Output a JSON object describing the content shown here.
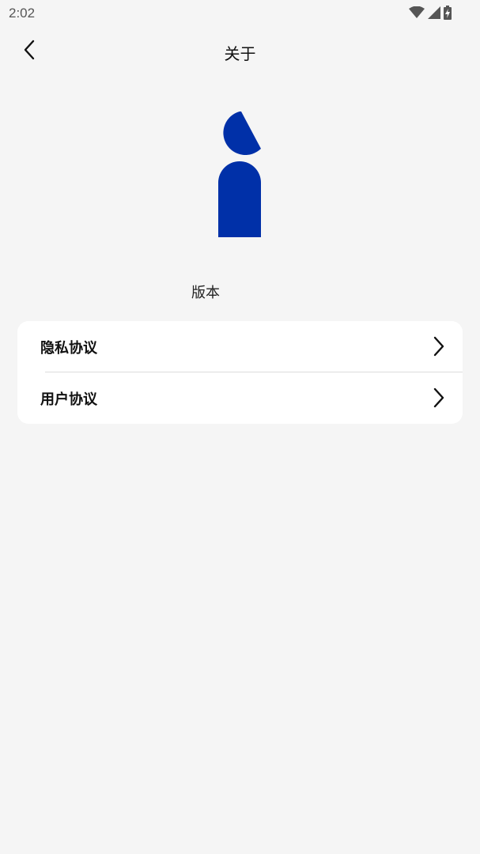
{
  "status_bar": {
    "time": "2:02",
    "icons": [
      "wifi-icon",
      "cellular-signal-icon",
      "battery-charging-icon"
    ]
  },
  "app_bar": {
    "title": "关于",
    "back_icon": "chevron-left-icon"
  },
  "logo": {
    "icon": "app-logo-i",
    "color": "#0030a8"
  },
  "version": {
    "label": "版本"
  },
  "settings": {
    "items": [
      {
        "label": "隐私协议",
        "icon": "chevron-right-icon"
      },
      {
        "label": "用户协议",
        "icon": "chevron-right-icon"
      }
    ]
  },
  "colors": {
    "background": "#f5f5f5",
    "card": "#ffffff",
    "brand": "#0030a8"
  }
}
